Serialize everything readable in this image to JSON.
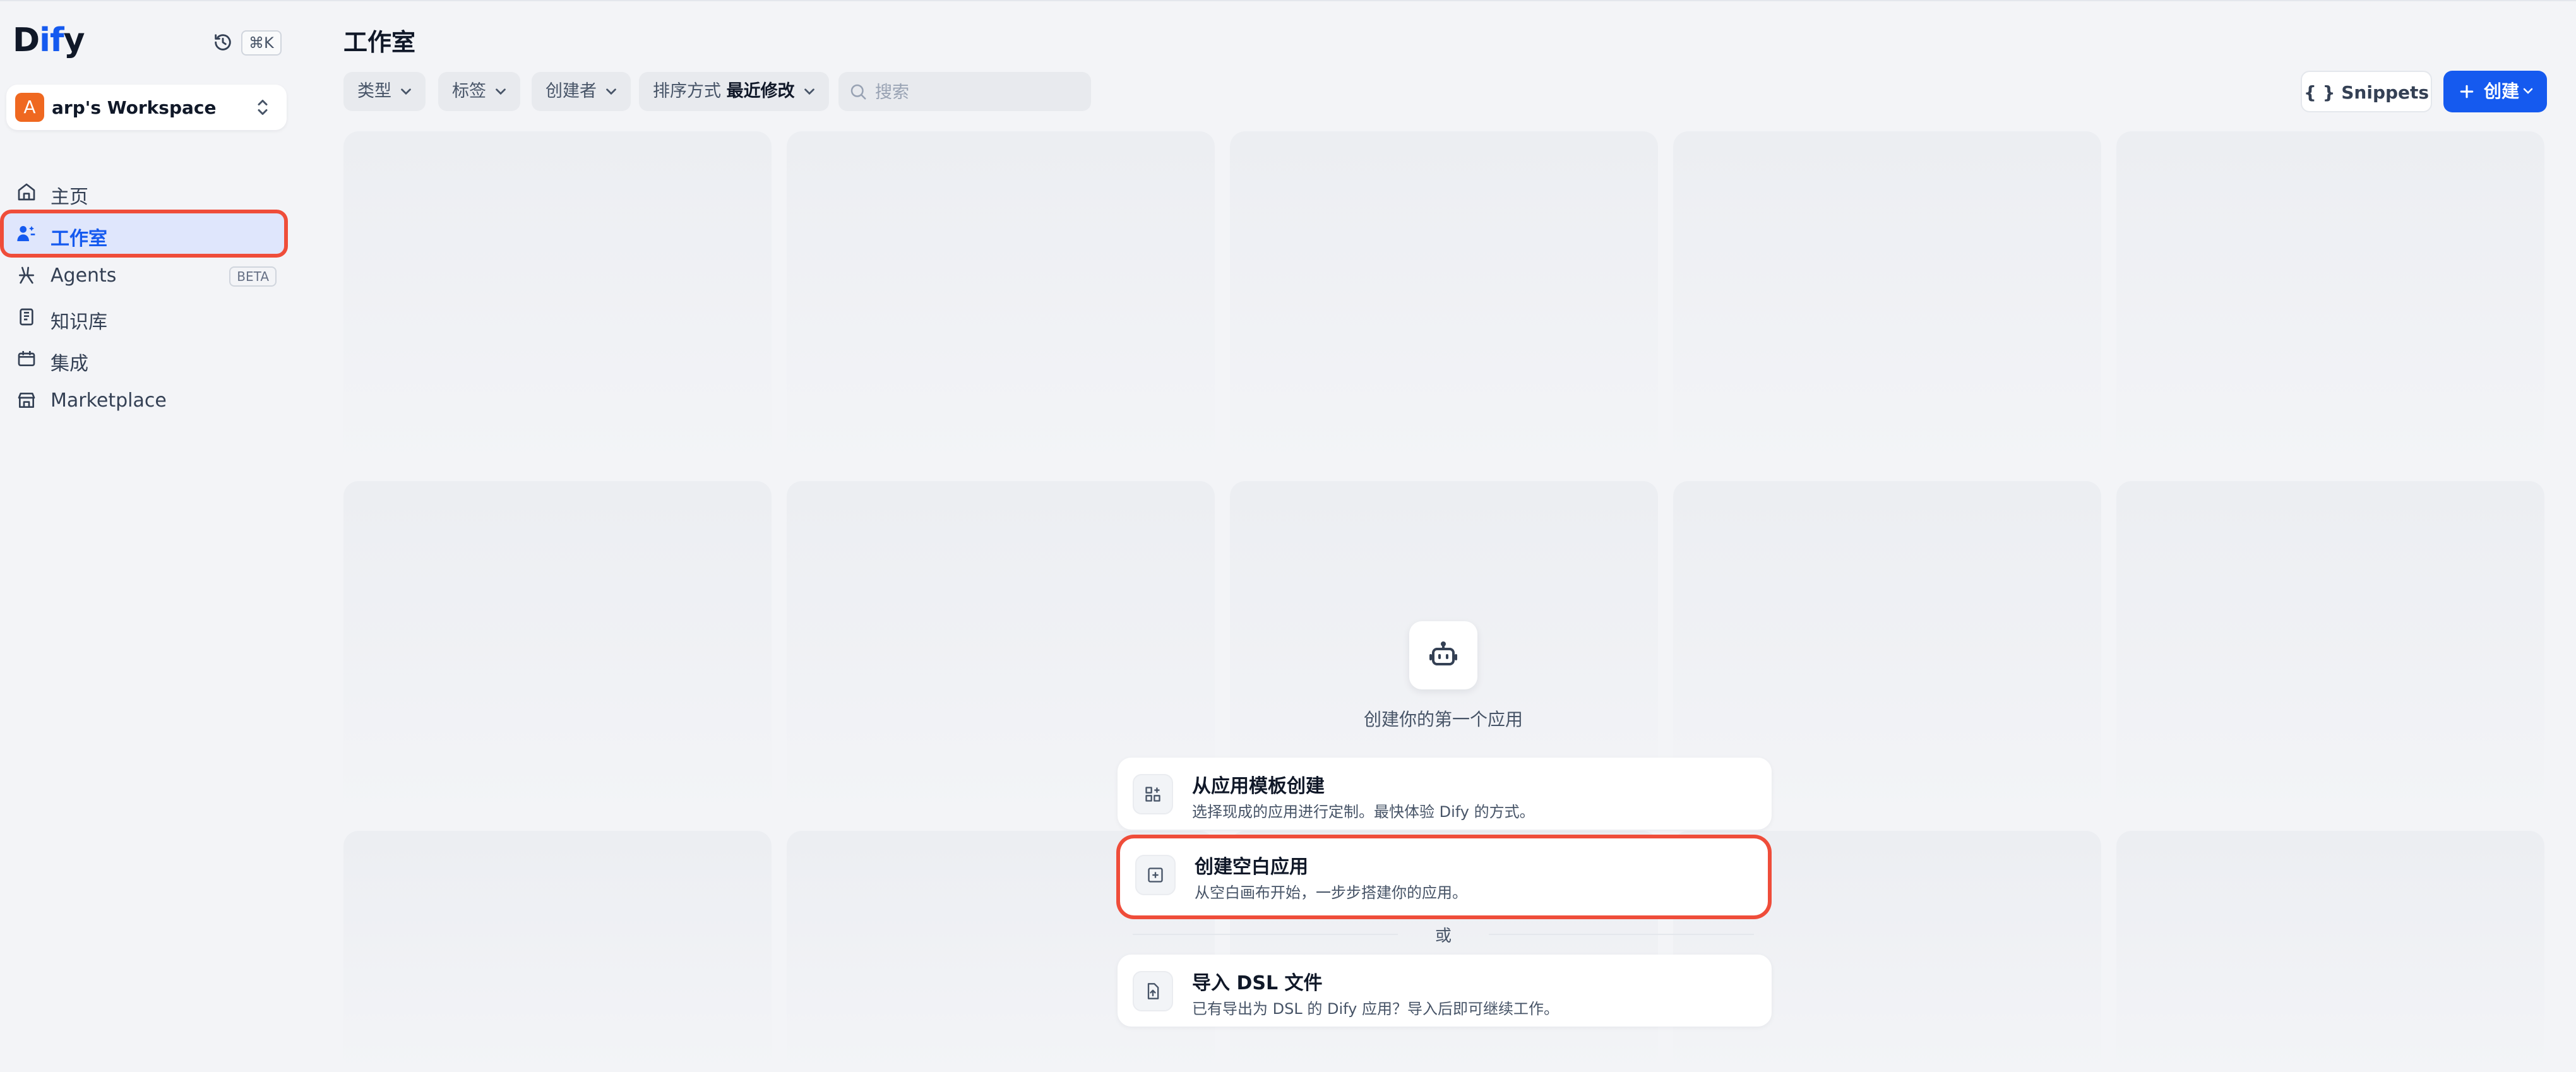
{
  "brand": {
    "logo_left": "D",
    "logo_mid": "if",
    "logo_right": "y",
    "shortcut": "⌘K"
  },
  "workspace": {
    "avatar": "A",
    "name": "arp's Workspace"
  },
  "nav": [
    {
      "label": "主页",
      "icon": "home-icon"
    },
    {
      "label": "工作室",
      "icon": "studio-icon",
      "active": true
    },
    {
      "label": "Agents",
      "icon": "agents-icon",
      "badge": "BETA"
    },
    {
      "label": "知识库",
      "icon": "knowledge-icon"
    },
    {
      "label": "集成",
      "icon": "integration-icon"
    },
    {
      "label": "Marketplace",
      "icon": "marketplace-icon"
    }
  ],
  "header": {
    "title": "工作室"
  },
  "filters": {
    "type": "类型",
    "tags": "标签",
    "creator": "创建者",
    "sort_prefix": "排序方式",
    "sort_value": "最近修改",
    "search_placeholder": "搜索"
  },
  "actions": {
    "snippets": "{ } Snippets",
    "create": "创建"
  },
  "empty_state": {
    "caption": "创建你的第一个应用",
    "options": [
      {
        "title": "从应用模板创建",
        "desc": "选择现成的应用进行定制。最快体验 Dify 的方式。"
      },
      {
        "title": "创建空白应用",
        "desc": "从空白画布开始，一步步搭建你的应用。"
      },
      {
        "title": "导入 DSL 文件",
        "desc": "已有导出为 DSL 的 Dify 应用？导入后即可继续工作。"
      }
    ],
    "or": "或"
  },
  "colors": {
    "accent": "#155aef",
    "highlight": "#ef4d3a",
    "avatar": "#ef6820"
  }
}
